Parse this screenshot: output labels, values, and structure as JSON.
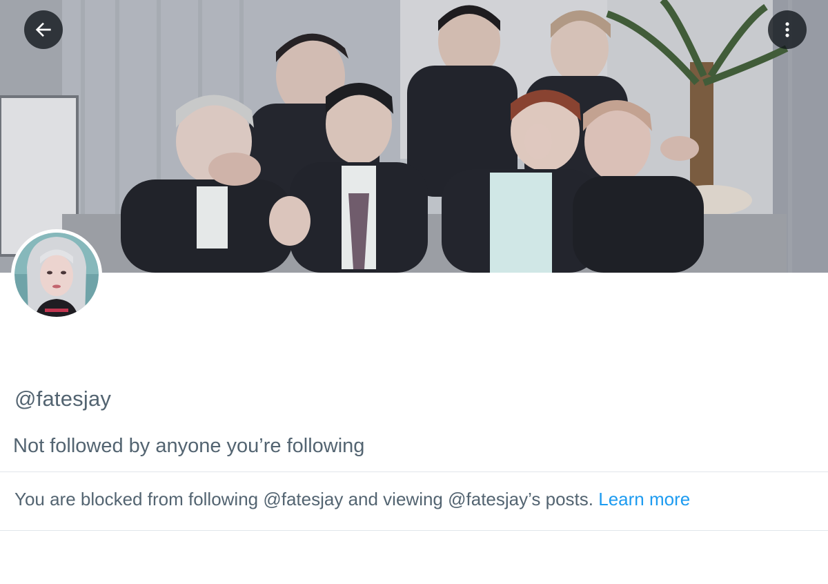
{
  "header": {
    "back_icon": "arrow-left-icon",
    "more_icon": "more-vertical-icon"
  },
  "profile": {
    "handle": "@fatesjay",
    "followed_by_text": "Not followed by anyone you’re following"
  },
  "blocked_notice": {
    "text": "You are blocked from following @fatesjay and viewing @fatesjay’s posts.",
    "link_label": "Learn more"
  },
  "colors": {
    "link": "#1d9bf0",
    "secondary_text": "#536471",
    "button_bg": "#0f1419"
  }
}
